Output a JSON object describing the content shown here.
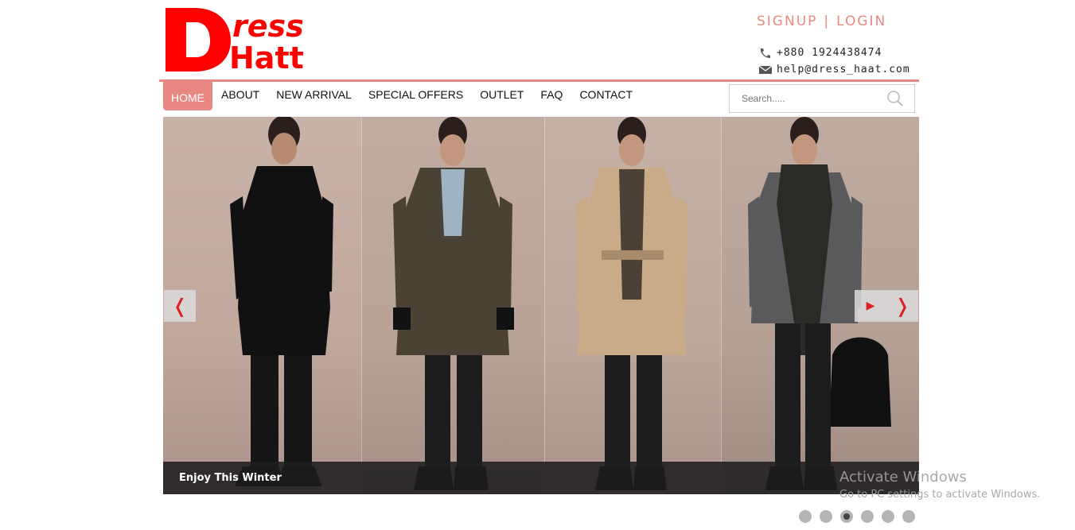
{
  "brand": {
    "logo_line1": "ress",
    "logo_line2": "Hatt",
    "logo_letter": "D",
    "color": "#ff0000"
  },
  "auth": {
    "signup": "SIGNUP",
    "separator": "|",
    "login": "LOGIN"
  },
  "contact": {
    "phone": "+880 1924438474",
    "email": "help@dress_haat.com"
  },
  "nav": {
    "items": [
      {
        "label": "HOME",
        "active": true
      },
      {
        "label": "ABOUT"
      },
      {
        "label": "NEW ARRIVAL"
      },
      {
        "label": "SPECIAL OFFERS"
      },
      {
        "label": "OUTLET"
      },
      {
        "label": "FAQ"
      },
      {
        "label": "CONTACT"
      }
    ]
  },
  "search": {
    "placeholder": "Search.....",
    "icon": "search-icon"
  },
  "slider": {
    "caption": "Enjoy This Winter",
    "prev_icon": "chevron-left-icon",
    "next_icon": "chevron-right-icon",
    "play_icon": "play-icon",
    "dots_count": 6,
    "active_dot": 3
  },
  "overlay": {
    "activate_title": "Activate Windows",
    "activate_sub": "Go to PC settings to activate Windows."
  },
  "colors": {
    "accent": "#e98882",
    "caption_bg": "#1e1e1e",
    "arrow": "#e02020"
  }
}
